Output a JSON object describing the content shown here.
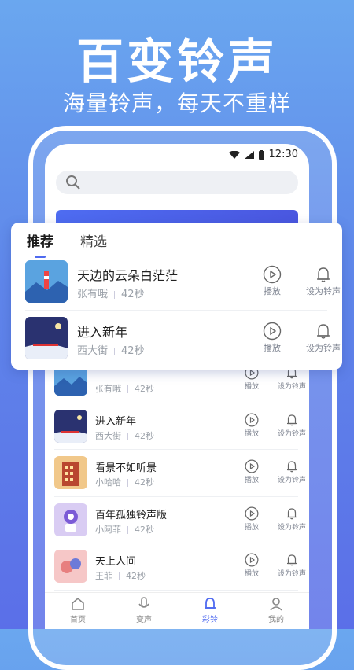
{
  "promo": {
    "headline": "百变铃声",
    "subline": "海量铃声，每天不重样"
  },
  "status": {
    "time": "12:30"
  },
  "card": {
    "tabs": [
      {
        "label": "推荐"
      },
      {
        "label": "精选"
      }
    ],
    "items": [
      {
        "title": "天边的云朵白茫茫",
        "artist": "张有哦",
        "duration": "42秒"
      },
      {
        "title": "进入新年",
        "artist": "西大街",
        "duration": "42秒"
      }
    ]
  },
  "actions": {
    "play": "播放",
    "set": "设为铃声"
  },
  "list": [
    {
      "title": "",
      "artist": "张有哦",
      "duration": "42秒",
      "thumb": "mountain"
    },
    {
      "title": "进入新年",
      "artist": "西大街",
      "duration": "42秒",
      "thumb": "winter"
    },
    {
      "title": "看景不如听景",
      "artist": "小哈哈",
      "duration": "42秒",
      "thumb": "building"
    },
    {
      "title": "百年孤独铃声版",
      "artist": "小阿菲",
      "duration": "42秒",
      "thumb": "purple"
    },
    {
      "title": "天上人间",
      "artist": "王菲",
      "duration": "42秒",
      "thumb": "pink"
    },
    {
      "title": "看景不如听景",
      "artist": "",
      "duration": "",
      "thumb": "purple"
    }
  ],
  "tabbar": [
    {
      "label": "首页",
      "icon": "home-icon"
    },
    {
      "label": "变声",
      "icon": "microphone-icon"
    },
    {
      "label": "彩铃",
      "icon": "bell-icon"
    },
    {
      "label": "我的",
      "icon": "user-icon"
    }
  ],
  "colors": {
    "accent": "#4f6af0",
    "bg_top": "#6aa7ef",
    "bg_bottom": "#5b6fe8"
  }
}
